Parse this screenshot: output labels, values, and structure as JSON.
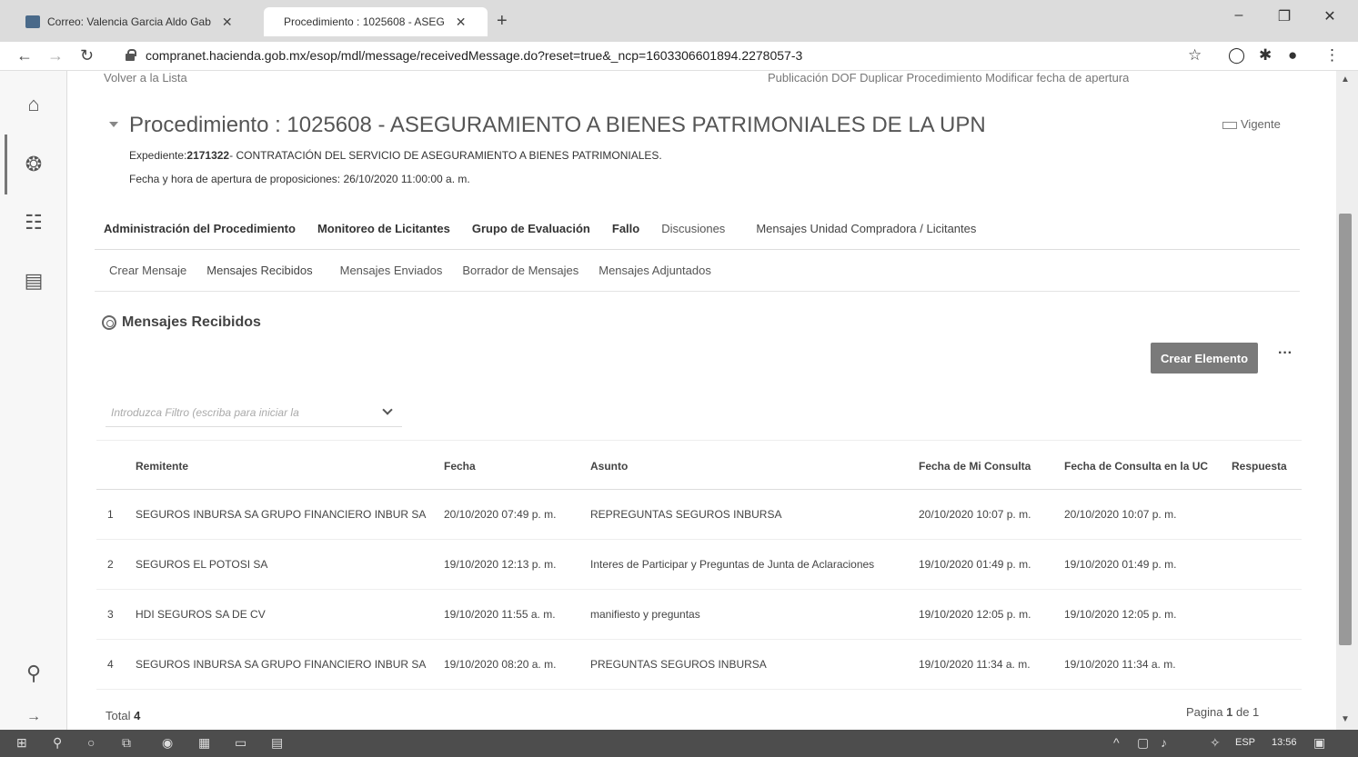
{
  "browser": {
    "tabs": [
      {
        "title": "Correo: Valencia Garcia Aldo Gab",
        "close": "✕"
      },
      {
        "title": "Procedimiento : 1025608 - ASEG",
        "close": "✕"
      }
    ],
    "new_tab": "+",
    "url": "compranet.hacienda.gob.mx/esop/mdl/message/receivedMessage.do?reset=true&_ncp=1603306601894.2278057-3",
    "window_controls": {
      "minimize": "–",
      "maximize": "❐",
      "close": "✕"
    }
  },
  "header_links": {
    "back": "Volver a la Lista",
    "right": "Publicación DOF    Duplicar Procedimiento    Modificar fecha de apertura"
  },
  "procedure": {
    "title": "Procedimiento : 1025608 - ASEGURAMIENTO A BIENES PATRIMONIALES DE LA UPN",
    "status": "Vigente",
    "expediente_label": "Expediente:",
    "expediente_number": "2171322",
    "expediente_desc": "- CONTRATACIÓN DEL SERVICIO DE ASEGURAMIENTO A BIENES PATRIMONIALES.",
    "opening": "Fecha y hora de apertura de proposiciones: 26/10/2020 11:00:00 a. m."
  },
  "main_tabs": [
    "Administración del Procedimiento",
    "Monitoreo de Licitantes",
    "Grupo de Evaluación",
    "Fallo",
    "Discusiones",
    "Mensajes Unidad Compradora / Licitantes"
  ],
  "sub_tabs": [
    "Crear Mensaje",
    "Mensajes Recibidos",
    "Mensajes Enviados",
    "Borrador de Mensajes",
    "Mensajes Adjuntados"
  ],
  "section_title": "Mensajes Recibidos",
  "actions": {
    "create": "Crear Elemento",
    "more": "···"
  },
  "filter": {
    "placeholder": "Introduzca Filtro (escriba para iniciar la"
  },
  "table": {
    "headers": [
      "Remitente",
      "Fecha",
      "Asunto",
      "Fecha de Mi Consulta",
      "Fecha de Consulta en la UC",
      "Respuesta"
    ],
    "rows": [
      {
        "n": "1",
        "remitente": "SEGUROS INBURSA SA GRUPO FINANCIERO INBUR SA",
        "fecha": "20/10/2020 07:49 p. m.",
        "asunto": "REPREGUNTAS SEGUROS INBURSA",
        "consulta": "20/10/2020 10:07 p. m.",
        "consulta_uc": "20/10/2020 10:07 p. m.",
        "respuesta": ""
      },
      {
        "n": "2",
        "remitente": "SEGUROS EL POTOSI SA",
        "fecha": "19/10/2020 12:13 p. m.",
        "asunto": "Interes de Participar y Preguntas de Junta de Aclaraciones",
        "consulta": "19/10/2020 01:49 p. m.",
        "consulta_uc": "19/10/2020 01:49 p. m.",
        "respuesta": ""
      },
      {
        "n": "3",
        "remitente": "HDI SEGUROS SA DE CV",
        "fecha": "19/10/2020 11:55 a. m.",
        "asunto": "manifiesto y preguntas",
        "consulta": "19/10/2020 12:05 p. m.",
        "consulta_uc": "19/10/2020 12:05 p. m.",
        "respuesta": ""
      },
      {
        "n": "4",
        "remitente": "SEGUROS INBURSA SA GRUPO FINANCIERO INBUR SA",
        "fecha": "19/10/2020 08:20 a. m.",
        "asunto": "PREGUNTAS SEGUROS INBURSA",
        "consulta": "19/10/2020 11:34 a. m.",
        "consulta_uc": "19/10/2020 11:34 a. m.",
        "respuesta": ""
      }
    ]
  },
  "footer": {
    "total_label": "Total",
    "total_value": "4",
    "page_label": "Pagina",
    "page_current": "1",
    "page_of": "de 1"
  },
  "taskbar": {
    "lang": "ESP",
    "time": "13:56"
  }
}
